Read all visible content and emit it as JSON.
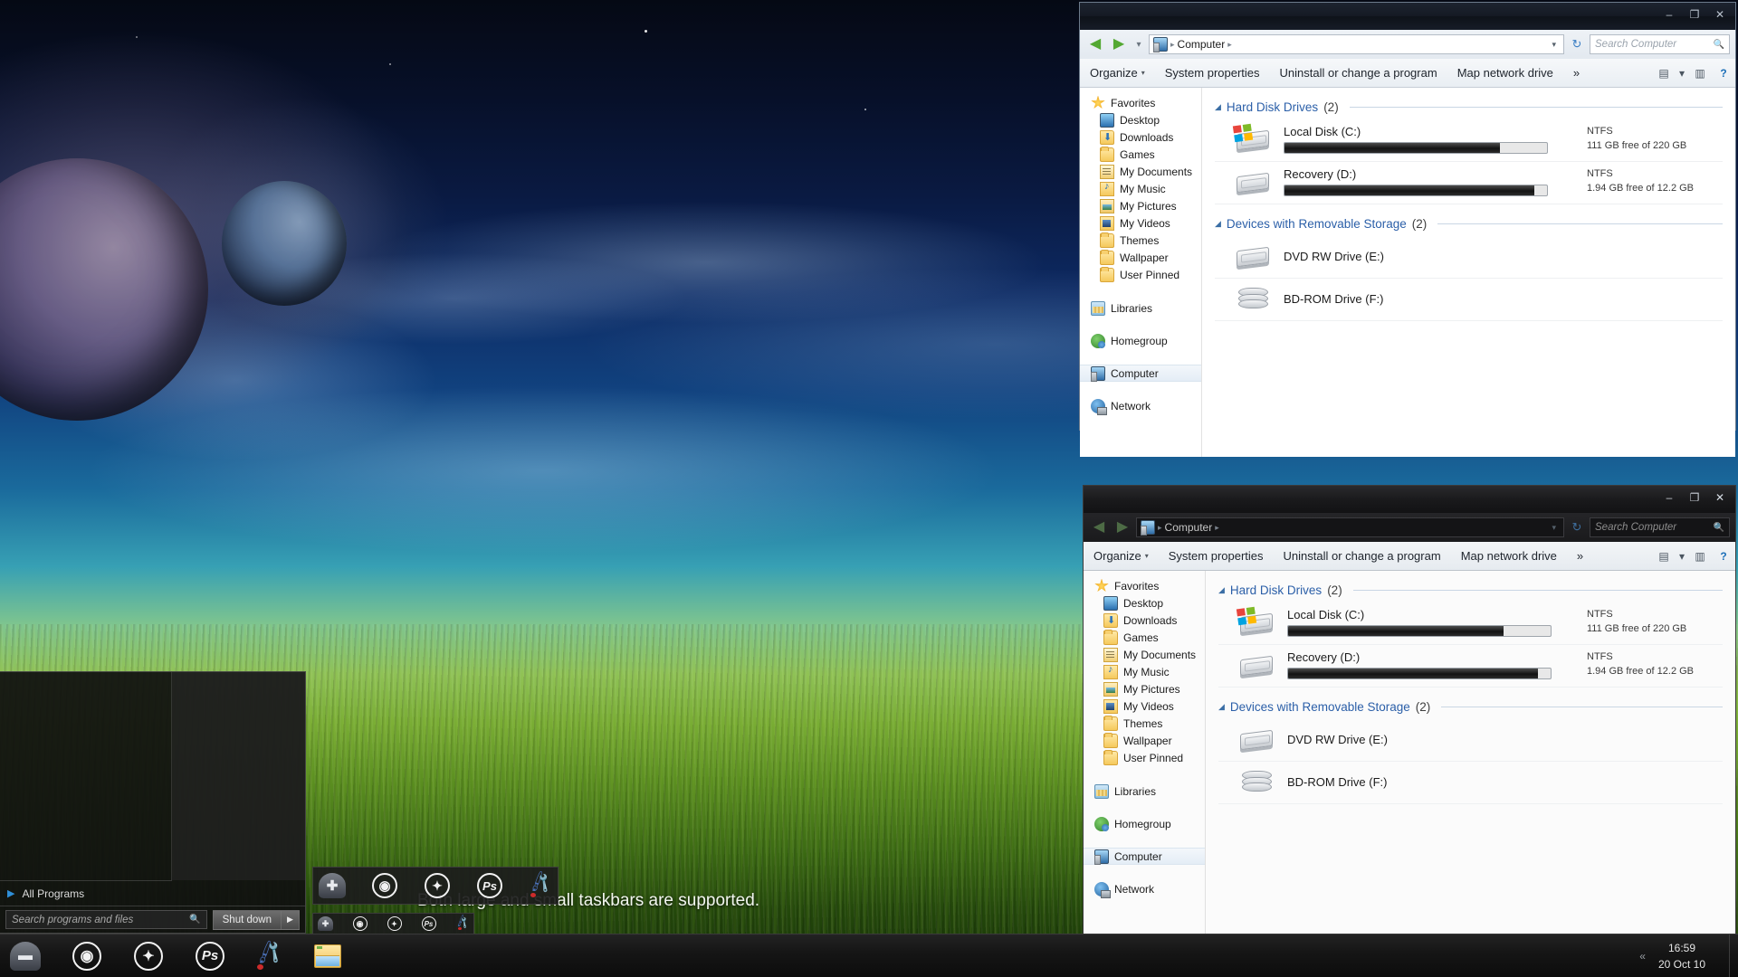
{
  "desktop": {
    "caption": "Both large and small taskbars are supported."
  },
  "explorer_window_light": {
    "title": "",
    "window_controls": {
      "minimize": "–",
      "maximize": "❐",
      "close": "✕"
    },
    "address": {
      "back_icon": "◀",
      "forward_icon": "▶",
      "history_caret": "▾",
      "computer_icon": "computer-icon",
      "breadcrumb": [
        "Computer"
      ],
      "crumb_sep": "▸",
      "dropdown_caret": "▾",
      "refresh_icon": "↻"
    },
    "search": {
      "placeholder": "Search Computer",
      "icon": "🔍"
    },
    "toolbar": {
      "organize": "Organize",
      "organize_caret": "▾",
      "system_properties": "System properties",
      "uninstall": "Uninstall or change a program",
      "map_network_drive": "Map network drive",
      "overflow": "»",
      "view_icon": "▤",
      "view_caret": "▾",
      "preview_icon": "▥",
      "help_icon": "?"
    },
    "navpane": {
      "favorites": {
        "label": "Favorites",
        "icon": "star-icon"
      },
      "favorites_children": [
        {
          "label": "Desktop",
          "icon": "monitor-icon"
        },
        {
          "label": "Downloads",
          "icon": "download-folder-icon"
        },
        {
          "label": "Games",
          "icon": "folder-icon"
        },
        {
          "label": "My Documents",
          "icon": "documents-folder-icon"
        },
        {
          "label": "My Music",
          "icon": "music-folder-icon"
        },
        {
          "label": "My Pictures",
          "icon": "pictures-folder-icon"
        },
        {
          "label": "My Videos",
          "icon": "videos-folder-icon"
        },
        {
          "label": "Themes",
          "icon": "folder-icon"
        },
        {
          "label": "Wallpaper",
          "icon": "folder-icon"
        },
        {
          "label": "User Pinned",
          "icon": "folder-icon"
        }
      ],
      "roots": [
        {
          "label": "Libraries",
          "icon": "libraries-icon",
          "selected": false
        },
        {
          "label": "Homegroup",
          "icon": "homegroup-icon",
          "selected": false
        },
        {
          "label": "Computer",
          "icon": "computer-icon",
          "selected": true
        },
        {
          "label": "Network",
          "icon": "network-icon",
          "selected": false
        }
      ]
    },
    "groups": [
      {
        "title": "Hard Disk Drives",
        "count": "(2)",
        "tri": "◢",
        "items": [
          {
            "name": "Local Disk (C:)",
            "icon": "windows-drive-icon",
            "fs": "NTFS",
            "free": "111 GB free of 220 GB",
            "used_pct": 82,
            "has_bar": true
          },
          {
            "name": "Recovery (D:)",
            "icon": "hdd-icon",
            "fs": "NTFS",
            "free": "1.94 GB free of 12.2 GB",
            "used_pct": 95,
            "has_bar": true
          }
        ]
      },
      {
        "title": "Devices with Removable Storage",
        "count": "(2)",
        "tri": "◢",
        "items": [
          {
            "name": "DVD RW Drive (E:)",
            "icon": "optical-drive-icon",
            "fs": "",
            "free": "",
            "used_pct": 0,
            "has_bar": false
          },
          {
            "name": "BD-ROM Drive (F:)",
            "icon": "bluray-drive-icon",
            "fs": "",
            "free": "",
            "used_pct": 0,
            "has_bar": false
          }
        ]
      }
    ]
  },
  "explorer_window_dark": {
    "title": "",
    "window_controls": {
      "minimize": "–",
      "maximize": "❐",
      "close": "✕"
    },
    "address": {
      "back_icon": "◀",
      "forward_icon": "▶",
      "computer_icon": "computer-icon",
      "breadcrumb": [
        "Computer"
      ],
      "crumb_sep": "▸",
      "dropdown_caret": "▾",
      "refresh_icon": "↻"
    },
    "search": {
      "placeholder": "Search Computer",
      "icon": "🔍"
    },
    "toolbar": {
      "organize": "Organize",
      "organize_caret": "▾",
      "system_properties": "System properties",
      "uninstall": "Uninstall or change a program",
      "map_network_drive": "Map network drive",
      "overflow": "»",
      "view_icon": "▤",
      "view_caret": "▾",
      "preview_icon": "▥",
      "help_icon": "?"
    },
    "navpane": {
      "favorites": {
        "label": "Favorites",
        "icon": "star-icon"
      },
      "favorites_children": [
        {
          "label": "Desktop",
          "icon": "monitor-icon"
        },
        {
          "label": "Downloads",
          "icon": "download-folder-icon"
        },
        {
          "label": "Games",
          "icon": "folder-icon"
        },
        {
          "label": "My Documents",
          "icon": "documents-folder-icon"
        },
        {
          "label": "My Music",
          "icon": "music-folder-icon"
        },
        {
          "label": "My Pictures",
          "icon": "pictures-folder-icon"
        },
        {
          "label": "My Videos",
          "icon": "videos-folder-icon"
        },
        {
          "label": "Themes",
          "icon": "folder-icon"
        },
        {
          "label": "Wallpaper",
          "icon": "folder-icon"
        },
        {
          "label": "User Pinned",
          "icon": "folder-icon"
        }
      ],
      "roots": [
        {
          "label": "Libraries",
          "icon": "libraries-icon",
          "selected": false
        },
        {
          "label": "Homegroup",
          "icon": "homegroup-icon",
          "selected": false
        },
        {
          "label": "Computer",
          "icon": "computer-icon",
          "selected": true
        },
        {
          "label": "Network",
          "icon": "network-icon",
          "selected": false
        }
      ]
    },
    "groups": [
      {
        "title": "Hard Disk Drives",
        "count": "(2)",
        "tri": "◢",
        "items": [
          {
            "name": "Local Disk (C:)",
            "icon": "windows-drive-icon",
            "fs": "NTFS",
            "free": "111 GB free of 220 GB",
            "used_pct": 82,
            "has_bar": true
          },
          {
            "name": "Recovery (D:)",
            "icon": "hdd-icon",
            "fs": "NTFS",
            "free": "1.94 GB free of 12.2 GB",
            "used_pct": 95,
            "has_bar": true
          }
        ]
      },
      {
        "title": "Devices with Removable Storage",
        "count": "(2)",
        "tri": "◢",
        "items": [
          {
            "name": "DVD RW Drive (E:)",
            "icon": "optical-drive-icon",
            "fs": "",
            "free": "",
            "used_pct": 0,
            "has_bar": false
          },
          {
            "name": "BD-ROM Drive (F:)",
            "icon": "bluray-drive-icon",
            "fs": "",
            "free": "",
            "used_pct": 0,
            "has_bar": false
          }
        ]
      }
    ]
  },
  "start_menu": {
    "all_programs": "All Programs",
    "all_programs_arrow": "▶",
    "search_placeholder": "Search programs and files",
    "search_icon": "🔍",
    "shutdown": "Shut down",
    "shutdown_arrow": "▶"
  },
  "taskbars": {
    "floating_large": [
      {
        "name": "start-orb",
        "glyph": "✚"
      },
      {
        "name": "chrome-icon",
        "glyph": "◉"
      },
      {
        "name": "utorrent-icon",
        "glyph": "✦"
      },
      {
        "name": "photoshop-icon",
        "glyph": "Ps"
      },
      {
        "name": "tools-icon",
        "glyph": ""
      }
    ],
    "floating_small": [
      {
        "name": "start-orb",
        "glyph": "✚"
      },
      {
        "name": "chrome-icon",
        "glyph": "◉"
      },
      {
        "name": "utorrent-icon",
        "glyph": "✦"
      },
      {
        "name": "photoshop-icon",
        "glyph": "Ps"
      },
      {
        "name": "tools-icon",
        "glyph": ""
      }
    ],
    "main": [
      {
        "name": "start-orb",
        "glyph": "▬"
      },
      {
        "name": "chrome-icon",
        "glyph": "◉"
      },
      {
        "name": "utorrent-icon",
        "glyph": "✦"
      },
      {
        "name": "photoshop-icon",
        "glyph": "Ps"
      },
      {
        "name": "tools-icon",
        "glyph": ""
      },
      {
        "name": "explorer-icon",
        "glyph": ""
      }
    ],
    "tray": {
      "chevron": "«"
    },
    "clock": {
      "time": "16:59",
      "date": "20 Oct 10"
    }
  },
  "colors": {
    "accent_blue": "#2b5fa8",
    "green_nav": "#53a832",
    "taskbar_bg": "#161616"
  }
}
